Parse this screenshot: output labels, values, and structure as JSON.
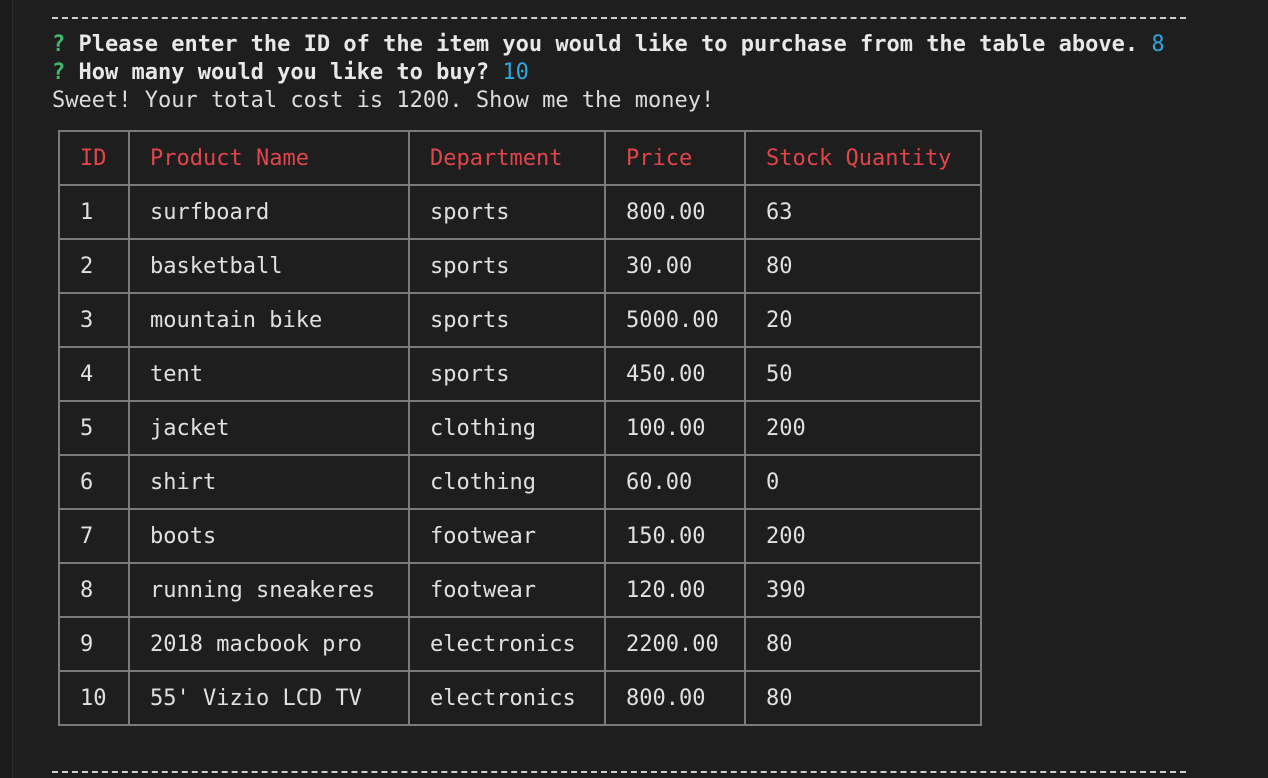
{
  "session": {
    "prompt_id": {
      "marker": "?",
      "text": "Please enter the ID of the item you would like to purchase from the table above.",
      "answer": "8"
    },
    "prompt_qty": {
      "marker": "?",
      "text": "How many would you like to buy?",
      "answer": "10"
    },
    "result_message": "Sweet! Your total cost is 1200. Show me the money!"
  },
  "table": {
    "headers": [
      "ID",
      "Product Name",
      "Department",
      "Price",
      "Stock Quantity"
    ],
    "rows": [
      [
        "1",
        "surfboard",
        "sports",
        "800.00",
        "63"
      ],
      [
        "2",
        "basketball",
        "sports",
        "30.00",
        "80"
      ],
      [
        "3",
        "mountain bike",
        "sports",
        "5000.00",
        "20"
      ],
      [
        "4",
        "tent",
        "sports",
        "450.00",
        "50"
      ],
      [
        "5",
        "jacket",
        "clothing",
        "100.00",
        "200"
      ],
      [
        "6",
        "shirt",
        "clothing",
        "60.00",
        "0"
      ],
      [
        "7",
        "boots",
        "footwear",
        "150.00",
        "200"
      ],
      [
        "8",
        "running sneakeres",
        "footwear",
        "120.00",
        "390"
      ],
      [
        "9",
        "2018 macbook pro",
        "electronics",
        "2200.00",
        "80"
      ],
      [
        "10",
        "55' Vizio LCD TV",
        "electronics",
        "800.00",
        "80"
      ]
    ]
  },
  "colors": {
    "background": "#1e1e1e",
    "prompt_marker": "#3fb96b",
    "answer": "#2aa7de",
    "table_header": "#e0454b",
    "table_border": "#7a7a7a"
  }
}
